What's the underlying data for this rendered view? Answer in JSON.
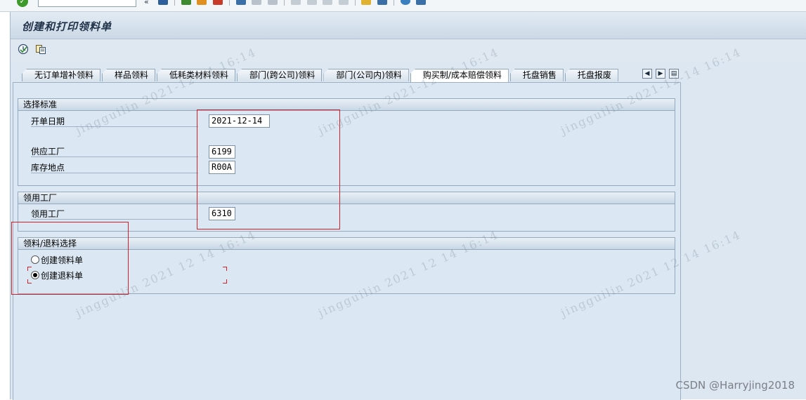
{
  "window": {
    "title": "创建和打印领料单"
  },
  "tabs": [
    {
      "label": "无订单增补领料",
      "active": false
    },
    {
      "label": "样品领料",
      "active": false
    },
    {
      "label": "低耗类材料领料",
      "active": false
    },
    {
      "label": "部门(跨公司)领料",
      "active": false
    },
    {
      "label": "部门(公司内)领料",
      "active": false
    },
    {
      "label": "购买制/成本赔偿领料",
      "active": true
    },
    {
      "label": "托盘销售",
      "active": false
    },
    {
      "label": "托盘报废",
      "active": false
    }
  ],
  "selection": {
    "title": "选择标准",
    "open_date_label": "开单日期",
    "open_date_value": "2021-12-14",
    "supply_plant_label": "供应工厂",
    "supply_plant_value": "6199",
    "storage_location_label": "库存地点",
    "storage_location_value": "R00A"
  },
  "receiving": {
    "title": "领用工厂",
    "plant_label": "领用工厂",
    "plant_value": "6310"
  },
  "issue_return": {
    "title": "领料/退料选择",
    "options": [
      {
        "label": "创建领料单",
        "selected": false
      },
      {
        "label": "创建退料单",
        "selected": true
      }
    ]
  },
  "watermark": {
    "lines": [
      "jingguilin 2021-12-14 16:14",
      "jingguilin 2021 12 14 16:14",
      "jingguilin 2021-12-14"
    ]
  },
  "credit": "CSDN @Harryjing2018",
  "colors": {
    "accent_red": "#d0202a",
    "panel_bg": "#dbe7f2",
    "title_text": "#21334a"
  }
}
